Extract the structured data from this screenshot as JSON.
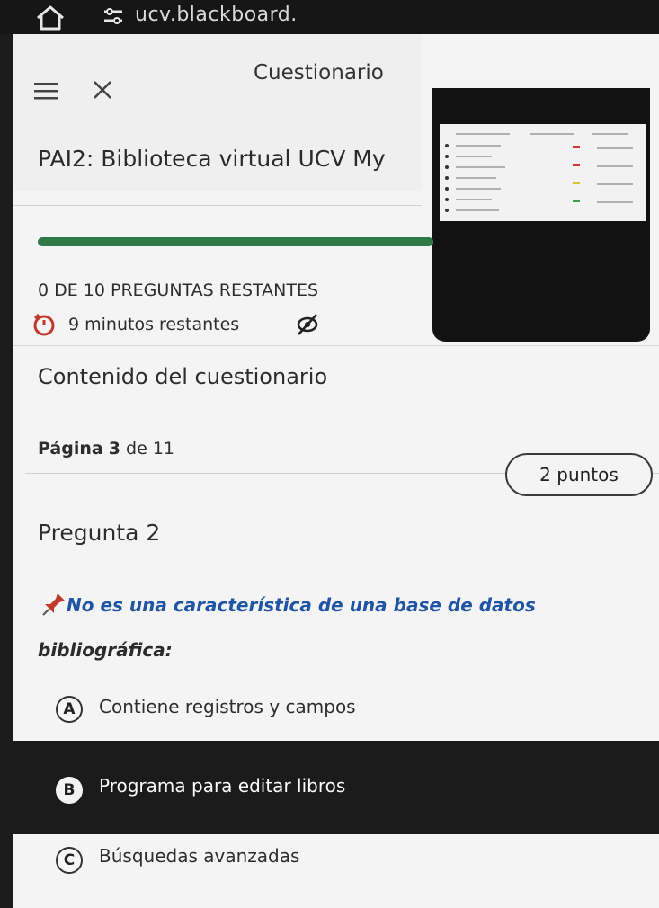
{
  "browser": {
    "url": "ucv.blackboard.",
    "icons": [
      "home-icon",
      "tune-icon"
    ]
  },
  "header": {
    "title": "Cuestionario",
    "icons": [
      "menu-icon",
      "close-icon"
    ]
  },
  "quiz": {
    "title": "PAI2: Biblioteca virtual UCV My",
    "progress_fraction": 1.0,
    "remaining": "0 DE 10 PREGUNTAS RESTANTES",
    "timer": "9 minutos restantes"
  },
  "content": {
    "heading": "Contenido del cuestionario",
    "page_label": "Página",
    "page_num": "3",
    "page_of": "de 11"
  },
  "question": {
    "title": "Pregunta 2",
    "points": "2 puntos",
    "text_part1": "No es una característica de una base de datos",
    "text_part2": "bibliográfica:",
    "options": [
      {
        "letter": "A",
        "text": "Contiene registros y campos",
        "selected": false
      },
      {
        "letter": "B",
        "text": "Programa para editar libros",
        "selected": true
      },
      {
        "letter": "C",
        "text": "Búsquedas avanzadas",
        "selected": false
      }
    ]
  },
  "colors": {
    "progress": "#2f7a44",
    "question_text": "#1f55a3",
    "selected_option_bg": "#1b1b1b"
  }
}
